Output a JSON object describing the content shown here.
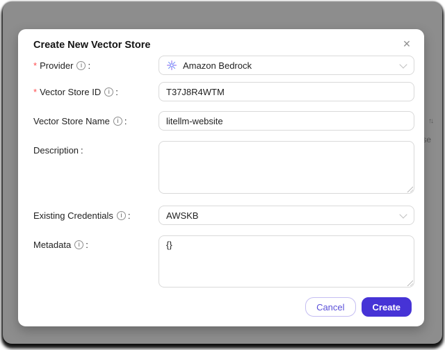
{
  "background": {
    "partial_sort_icon": "↑↓",
    "partial_text": "se"
  },
  "modal": {
    "title": "Create New Vector Store",
    "close_icon": "✕",
    "required_mark": "*",
    "info_glyph": "i",
    "colon": ":",
    "fields": {
      "provider": {
        "label": "Provider",
        "required": true,
        "value": "Amazon Bedrock",
        "icon": "bedrock-logo-icon"
      },
      "vector_store_id": {
        "label": "Vector Store ID",
        "required": true,
        "value": "T37J8R4WTM"
      },
      "vector_store_name": {
        "label": "Vector Store Name",
        "value": "litellm-website"
      },
      "description": {
        "label": "Description",
        "value": ""
      },
      "existing_credentials": {
        "label": "Existing Credentials",
        "value": "AWSKB"
      },
      "metadata": {
        "label": "Metadata",
        "value": "{}"
      }
    },
    "footer": {
      "cancel_label": "Cancel",
      "create_label": "Create"
    }
  },
  "colors": {
    "primary": "#4633d6",
    "cancel_text": "#5a4fd9",
    "cancel_border": "#c4bdf2",
    "overlay_gray": "#8d8d8d",
    "required_red": "#ff4d4f",
    "input_border": "#d9d9d9"
  }
}
